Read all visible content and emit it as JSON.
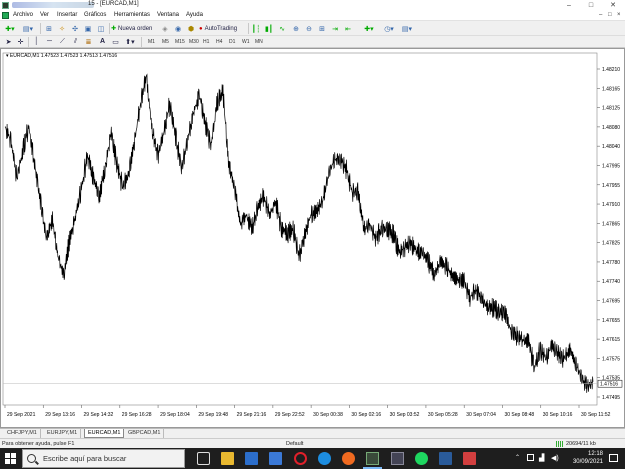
{
  "window": {
    "title": "15 - [EURCAD,M1]",
    "minimize": "–",
    "maximize": "□",
    "close": "✕"
  },
  "menu": {
    "items": [
      "Archivo",
      "Ver",
      "Insertar",
      "Gráficos",
      "Herramientas",
      "Ventana",
      "Ayuda"
    ],
    "mdi": [
      "–",
      "□",
      "×"
    ]
  },
  "toolbar": {
    "new_order": "Nueva orden",
    "autotrading": "AutoTrading",
    "timeframes": [
      "M1",
      "M5",
      "M15",
      "M30",
      "H1",
      "H4",
      "D1",
      "W1",
      "MN"
    ]
  },
  "chart_data": {
    "type": "line",
    "symbol_label": "EURCAD,M1  1.47523 1.47523 1.47513 1.47516",
    "price_ticks": [
      "1.48210",
      "1.48165",
      "1.48125",
      "1.48080",
      "1.48040",
      "1.47995",
      "1.47955",
      "1.47910",
      "1.47865",
      "1.47825",
      "1.47780",
      "1.47740",
      "1.47695",
      "1.47655",
      "1.47615",
      "1.47575",
      "1.47535",
      "1.47495"
    ],
    "current_price": "1.47516",
    "ylim": [
      1.4747,
      1.4823
    ],
    "time_ticks": [
      "29 Sep 2021",
      "29 Sep 13:16",
      "29 Sep 14:32",
      "29 Sep 16:28",
      "29 Sep 18:04",
      "29 Sep 19:48",
      "29 Sep 21:16",
      "29 Sep 22:52",
      "30 Sep 00:38",
      "30 Sep 02:16",
      "30 Sep 03:52",
      "30 Sep 05:28",
      "30 Sep 07:04",
      "30 Sep 08:48",
      "30 Sep 10:16",
      "30 Sep 11:52"
    ],
    "series": [
      {
        "values": [
          1.4807,
          1.4804,
          1.4796,
          1.4802,
          1.4807,
          1.4799,
          1.4791,
          1.4783,
          1.4787,
          1.4779,
          1.4775,
          1.4783,
          1.4788,
          1.4794,
          1.4801,
          1.4796,
          1.4792,
          1.4798,
          1.4806,
          1.4799,
          1.4794,
          1.4797,
          1.4804,
          1.4812,
          1.4818,
          1.4806,
          1.4801,
          1.4806,
          1.4812,
          1.4805,
          1.4798,
          1.4804,
          1.481,
          1.4814,
          1.4808,
          1.4803,
          1.4812,
          1.4815,
          1.4799,
          1.4794,
          1.4786,
          1.4788,
          1.4785,
          1.479,
          1.4792,
          1.4788,
          1.4791,
          1.4785,
          1.4784,
          1.4785,
          1.4779,
          1.4784,
          1.4788,
          1.4789,
          1.4791,
          1.4797,
          1.48,
          1.48,
          1.4798,
          1.4793,
          1.4793,
          1.4785,
          1.4786,
          1.4783,
          1.4785,
          1.4785,
          1.4784,
          1.478,
          1.4781,
          1.4782,
          1.478,
          1.478,
          1.4778,
          1.4775,
          1.4778,
          1.4777,
          1.4775,
          1.4774,
          1.4774,
          1.477,
          1.4772,
          1.477,
          1.4768,
          1.4768,
          1.4767,
          1.4767,
          1.4763,
          1.4762,
          1.4761,
          1.4761,
          1.4755,
          1.4759,
          1.4757,
          1.476,
          1.4758,
          1.4757,
          1.4759,
          1.4756,
          1.4753,
          1.4751,
          1.4752
        ]
      }
    ]
  },
  "tabs": [
    "CHFJPY,M1",
    "EURJPY,M1",
    "EURCAD,M1",
    "GBPCAD,M1"
  ],
  "active_tab": "EURCAD,M1",
  "status": {
    "help": "Para obtener ayuda, pulse F1",
    "profile": "Default",
    "traffic": "20694/11 kb"
  },
  "taskbar": {
    "search_placeholder": "Escribe aquí para buscar",
    "time": "12:18",
    "date": "30/09/2021"
  },
  "colors": {
    "chart_bg": "#ffffff",
    "chart_line": "#000000",
    "taskbar_bg": "#1e1e1e"
  }
}
